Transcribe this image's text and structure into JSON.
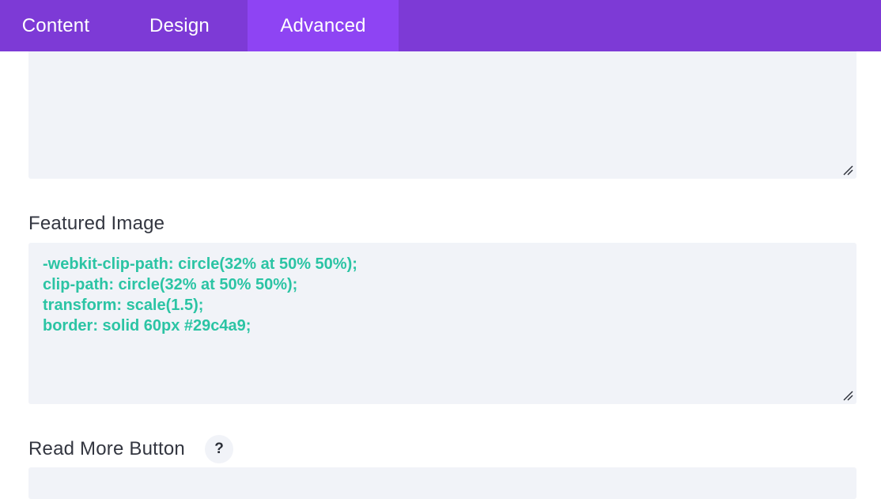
{
  "tabs": [
    {
      "label": "Content",
      "active": false
    },
    {
      "label": "Design",
      "active": false
    },
    {
      "label": "Advanced",
      "active": true
    }
  ],
  "fields": {
    "featured_image": {
      "label": "Featured Image",
      "value": "-webkit-clip-path: circle(32% at 50% 50%);\nclip-path: circle(32% at 50% 50%);\ntransform: scale(1.5);\nborder: solid 60px #29c4a9;"
    },
    "read_more_button": {
      "label": "Read More Button",
      "help_label": "?"
    }
  },
  "colors": {
    "tab_bar": "#7d3ad6",
    "active_tab": "#8e44f3",
    "field_bg": "#f1f3f8",
    "code_text": "#2bc4a4"
  },
  "icons": {
    "resize": "resize-handle-icon",
    "help": "help-icon"
  }
}
